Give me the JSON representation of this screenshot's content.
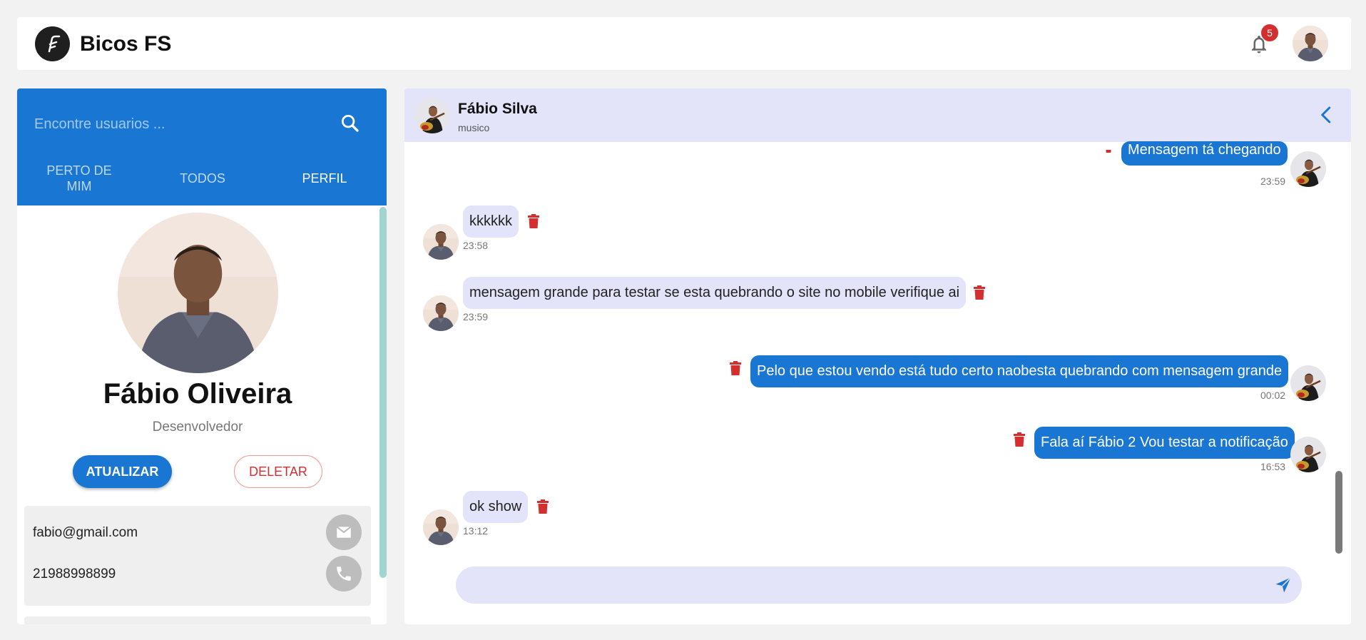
{
  "header": {
    "brand": "Bicos FS",
    "notifications_count": "5"
  },
  "sidebar": {
    "search_placeholder": "Encontre usuarios ...",
    "tabs": [
      {
        "label": "PERTO DE MIM"
      },
      {
        "label": "TODOS"
      },
      {
        "label": "PERFIL"
      }
    ],
    "active_tab": "PERFIL",
    "profile": {
      "name": "Fábio Oliveira",
      "role": "Desenvolvedor",
      "update_label": "ATUALIZAR",
      "delete_label": "DELETAR",
      "email": "fabio@gmail.com",
      "phone": "21988998899"
    }
  },
  "chat": {
    "contact_name": "Fábio Silva",
    "contact_subtitle": "musico",
    "messages": [
      {
        "direction": "out",
        "text": "Mensagem tá chegando",
        "time": "23:59"
      },
      {
        "direction": "in",
        "text": "kkkkkk",
        "time": "23:58"
      },
      {
        "direction": "in",
        "text": "mensagem grande para testar se esta quebrando o site no mobile verifique ai",
        "time": "23:59"
      },
      {
        "direction": "out",
        "text": "Pelo que estou vendo está tudo certo naobesta quebrando com mensagem grande",
        "time": "00:02"
      },
      {
        "direction": "out",
        "text": "Fala aí Fábio 2 Vou testar a notificação",
        "time": "16:53"
      },
      {
        "direction": "in",
        "text": "ok show",
        "time": "13:12"
      }
    ],
    "compose_placeholder": ""
  },
  "colors": {
    "primary": "#1976d2",
    "incoming_bubble": "#e3e3fa",
    "danger": "#d32f2f",
    "background": "#f2f2f2"
  }
}
